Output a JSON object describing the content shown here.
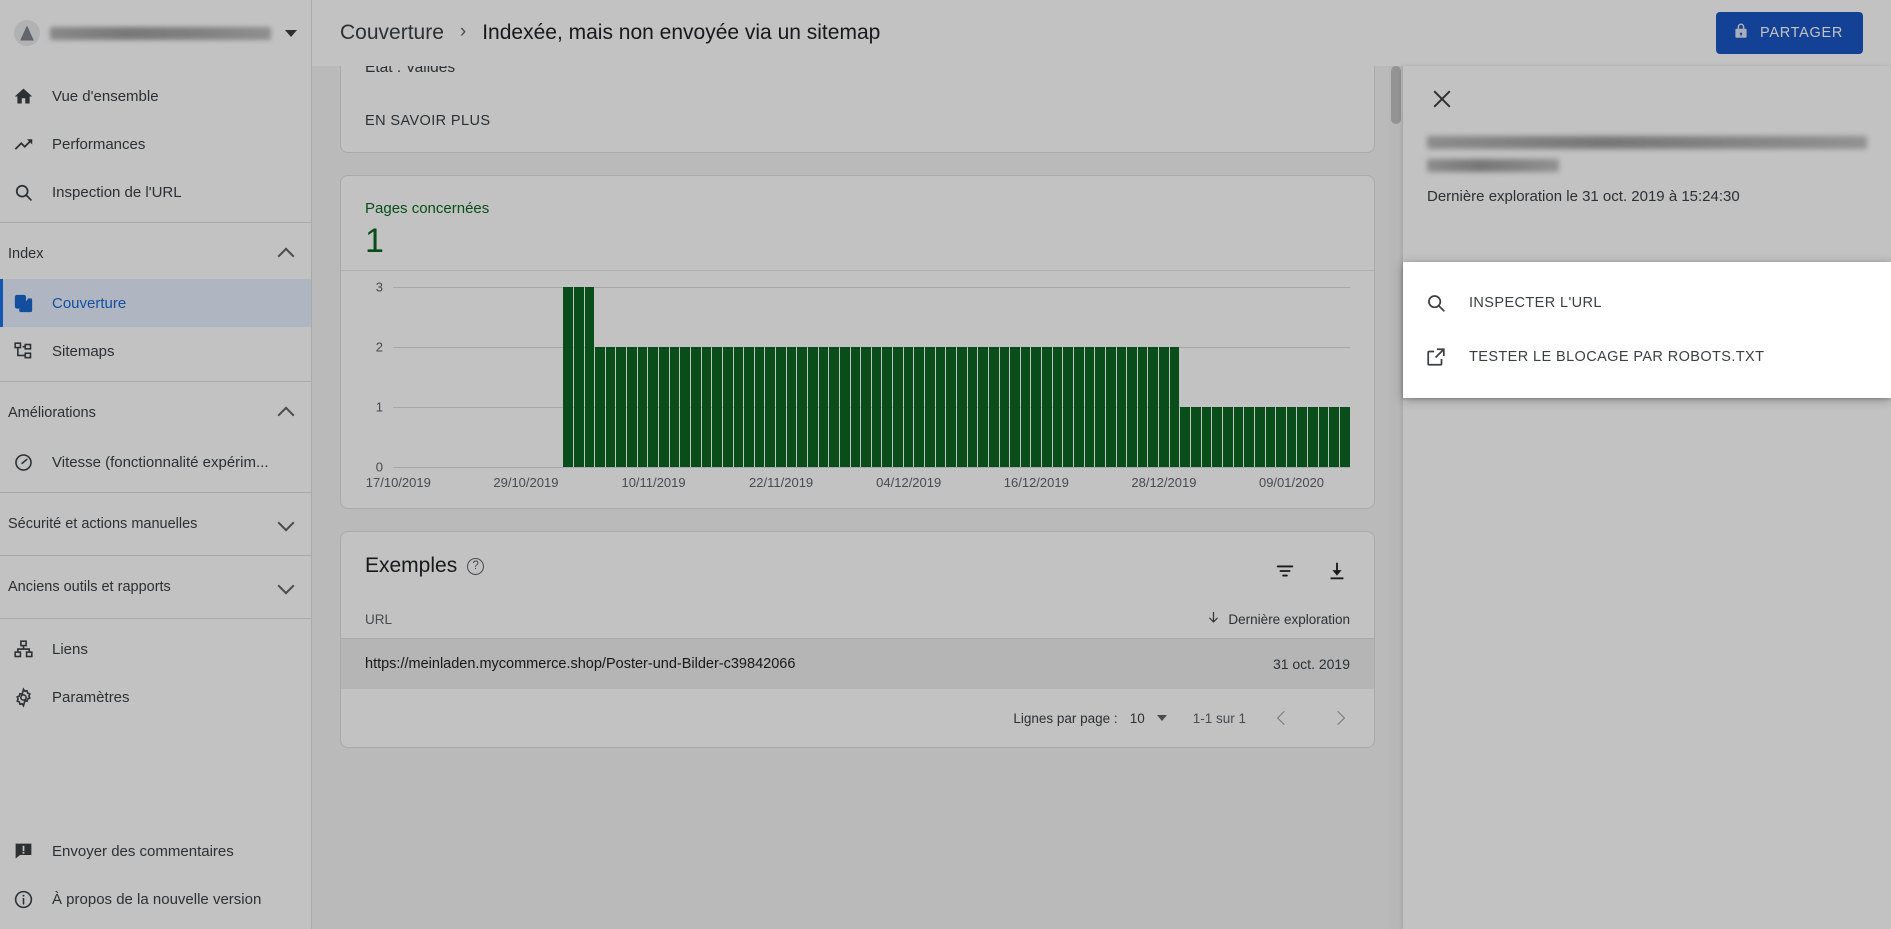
{
  "topbar": {
    "property_name_redacted": "",
    "breadcrumb_parent": "Couverture",
    "breadcrumb_separator": "›",
    "breadcrumb_current": "Indexée, mais non envoyée via un sitemap",
    "share_label": "PARTAGER",
    "share_icon": "lock-icon",
    "share_color": "#1a56c4",
    "caret_icon": "chevron-down-icon"
  },
  "sidebar": {
    "primary": [
      {
        "label": "Vue d'ensemble",
        "icon": "home-icon",
        "active": false
      },
      {
        "label": "Performances",
        "icon": "trending-up-icon",
        "active": false
      },
      {
        "label": "Inspection de l'URL",
        "icon": "search-icon",
        "active": false
      }
    ],
    "index_section": {
      "label": "Index",
      "chevron": "chevron-up-icon",
      "items": [
        {
          "label": "Couverture",
          "icon": "pages-icon",
          "active": true
        },
        {
          "label": "Sitemaps",
          "icon": "sitemap-icon",
          "active": false
        }
      ]
    },
    "enhancements_section": {
      "label": "Améliorations",
      "chevron": "chevron-up-icon",
      "items": [
        {
          "label": "Vitesse (fonctionnalité expérim...",
          "icon": "speed-icon",
          "active": false
        }
      ]
    },
    "security_section": {
      "label": "Sécurité et actions manuelles",
      "chevron": "chevron-down-icon"
    },
    "legacy_section": {
      "label": "Anciens outils et rapports",
      "chevron": "chevron-down-icon"
    },
    "bottom_items": [
      {
        "label": "Liens",
        "icon": "links-icon"
      },
      {
        "label": "Paramètres",
        "icon": "gear-icon"
      }
    ],
    "footer_items": [
      {
        "label": "Envoyer des commentaires",
        "icon": "feedback-icon"
      },
      {
        "label": "À propos de la nouvelle version",
        "icon": "info-icon"
      }
    ]
  },
  "detail_card": {
    "state_line": "État : Valides",
    "learn_more": "EN SAVOIR PLUS"
  },
  "chart_card": {
    "metric_label": "Pages concernées",
    "metric_value": "1",
    "accent_color": "#0b6623"
  },
  "chart_data": {
    "type": "bar",
    "title": "Pages concernées",
    "xlabel": "",
    "ylabel": "",
    "ylim": [
      0,
      3
    ],
    "yticks": [
      "0",
      "1",
      "2",
      "3"
    ],
    "grid": true,
    "legend": "none",
    "series_color": "#0b6623",
    "tick_labels": [
      "17/10/2019",
      "29/10/2019",
      "10/11/2019",
      "22/11/2019",
      "04/12/2019",
      "16/12/2019",
      "28/12/2019",
      "09/01/2020"
    ],
    "categories": [
      "17/10/2019",
      "18/10/2019",
      "19/10/2019",
      "20/10/2019",
      "21/10/2019",
      "22/10/2019",
      "23/10/2019",
      "24/10/2019",
      "25/10/2019",
      "26/10/2019",
      "27/10/2019",
      "28/10/2019",
      "29/10/2019",
      "30/10/2019",
      "31/10/2019",
      "01/11/2019",
      "02/11/2019",
      "03/11/2019",
      "04/11/2019",
      "05/11/2019",
      "06/11/2019",
      "07/11/2019",
      "08/11/2019",
      "09/11/2019",
      "10/11/2019",
      "11/11/2019",
      "12/11/2019",
      "13/11/2019",
      "14/11/2019",
      "15/11/2019",
      "16/11/2019",
      "17/11/2019",
      "18/11/2019",
      "19/11/2019",
      "20/11/2019",
      "21/11/2019",
      "22/11/2019",
      "23/11/2019",
      "24/11/2019",
      "25/11/2019",
      "26/11/2019",
      "27/11/2019",
      "28/11/2019",
      "29/11/2019",
      "30/11/2019",
      "01/12/2019",
      "02/12/2019",
      "03/12/2019",
      "04/12/2019",
      "05/12/2019",
      "06/12/2019",
      "07/12/2019",
      "08/12/2019",
      "09/12/2019",
      "10/12/2019",
      "11/12/2019",
      "12/12/2019",
      "13/12/2019",
      "14/12/2019",
      "15/12/2019",
      "16/12/2019",
      "17/12/2019",
      "18/12/2019",
      "19/12/2019",
      "20/12/2019",
      "21/12/2019",
      "22/12/2019",
      "23/12/2019",
      "24/12/2019",
      "25/12/2019",
      "26/12/2019",
      "27/12/2019",
      "28/12/2019",
      "29/12/2019",
      "30/12/2019",
      "31/12/2019",
      "01/01/2020",
      "02/01/2020",
      "03/01/2020",
      "04/01/2020",
      "05/01/2020",
      "06/01/2020",
      "07/01/2020",
      "08/01/2020",
      "09/01/2020",
      "10/01/2020",
      "11/01/2020",
      "12/01/2020",
      "13/01/2020",
      "14/01/2020"
    ],
    "values": [
      0,
      0,
      0,
      0,
      0,
      0,
      0,
      0,
      0,
      0,
      0,
      0,
      0,
      0,
      0,
      0,
      3,
      3,
      3,
      2,
      2,
      2,
      2,
      2,
      2,
      2,
      2,
      2,
      2,
      2,
      2,
      2,
      2,
      2,
      2,
      2,
      2,
      2,
      2,
      2,
      2,
      2,
      2,
      2,
      2,
      2,
      2,
      2,
      2,
      2,
      2,
      2,
      2,
      2,
      2,
      2,
      2,
      2,
      2,
      2,
      2,
      2,
      2,
      2,
      2,
      2,
      2,
      2,
      2,
      2,
      2,
      2,
      2,
      2,
      1,
      1,
      1,
      1,
      1,
      1,
      1,
      1,
      1,
      1,
      1,
      1,
      1,
      1,
      1,
      1
    ]
  },
  "examples": {
    "title": "Exemples",
    "help_glyph": "?",
    "help_icon": "help-circle-icon",
    "filter_icon": "filter-icon",
    "download_icon": "download-icon",
    "columns": {
      "url": "URL",
      "last_crawl": "Dernière exploration"
    },
    "sort_icon": "arrow-down-icon",
    "rows": [
      {
        "url": "https://meinladen.mycommerce.shop/Poster-und-Bilder-c39842066",
        "date": "31 oct. 2019",
        "selected": true
      }
    ],
    "pager": {
      "rows_per_page_label": "Lignes par page :",
      "rows_per_page_value": "10",
      "range": "1-1 sur 1",
      "prev_icon": "chevron-left-icon",
      "next_icon": "chevron-right-icon"
    }
  },
  "detail_panel": {
    "close_icon": "close-icon",
    "url_redacted": "",
    "crawl_line": "Dernière exploration le 31 oct. 2019 à 15:24:30",
    "context_menu": [
      {
        "label": "INSPECTER L'URL",
        "icon": "search-icon"
      },
      {
        "label": "TESTER LE BLOCAGE PAR ROBOTS.TXT",
        "icon": "external-link-icon"
      }
    ]
  }
}
